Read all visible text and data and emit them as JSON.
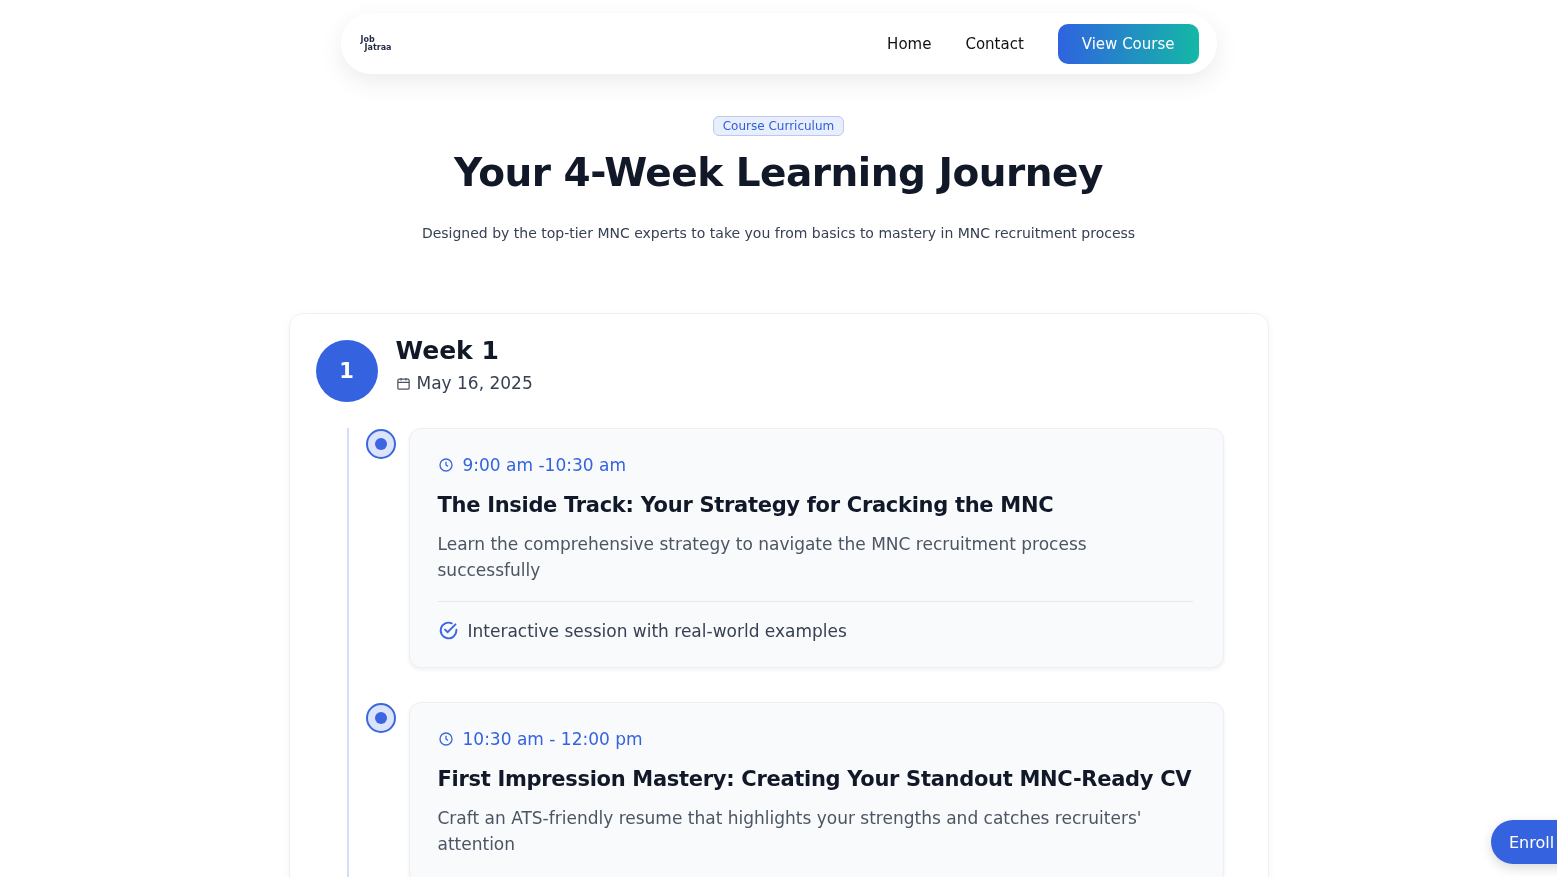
{
  "nav": {
    "logo": {
      "top": "Job",
      "bottom": "Jatraa"
    },
    "links": [
      {
        "label": "Home"
      },
      {
        "label": "Contact"
      }
    ],
    "cta": "View Course"
  },
  "header": {
    "badge": "Course Curriculum",
    "title": "Your 4-Week Learning Journey",
    "subtitle": "Designed by the top-tier MNC experts to take you from basics to mastery in MNC recruitment process"
  },
  "week": {
    "number": "1",
    "title": "Week 1",
    "date": "May 16, 2025",
    "sessions": [
      {
        "time": "9:00 am -10:30 am",
        "title": "The Inside Track: Your Strategy for Cracking the MNC",
        "description": "Learn the comprehensive strategy to navigate the MNC recruitment process successfully",
        "highlight": "Interactive session with real-world examples"
      },
      {
        "time": "10:30 am - 12:00 pm",
        "title": "First Impression Mastery: Creating Your Standout MNC-Ready CV",
        "description": "Craft an ATS-friendly resume that highlights your strengths and catches recruiters' attention"
      }
    ]
  },
  "floating_button": "Enroll"
}
